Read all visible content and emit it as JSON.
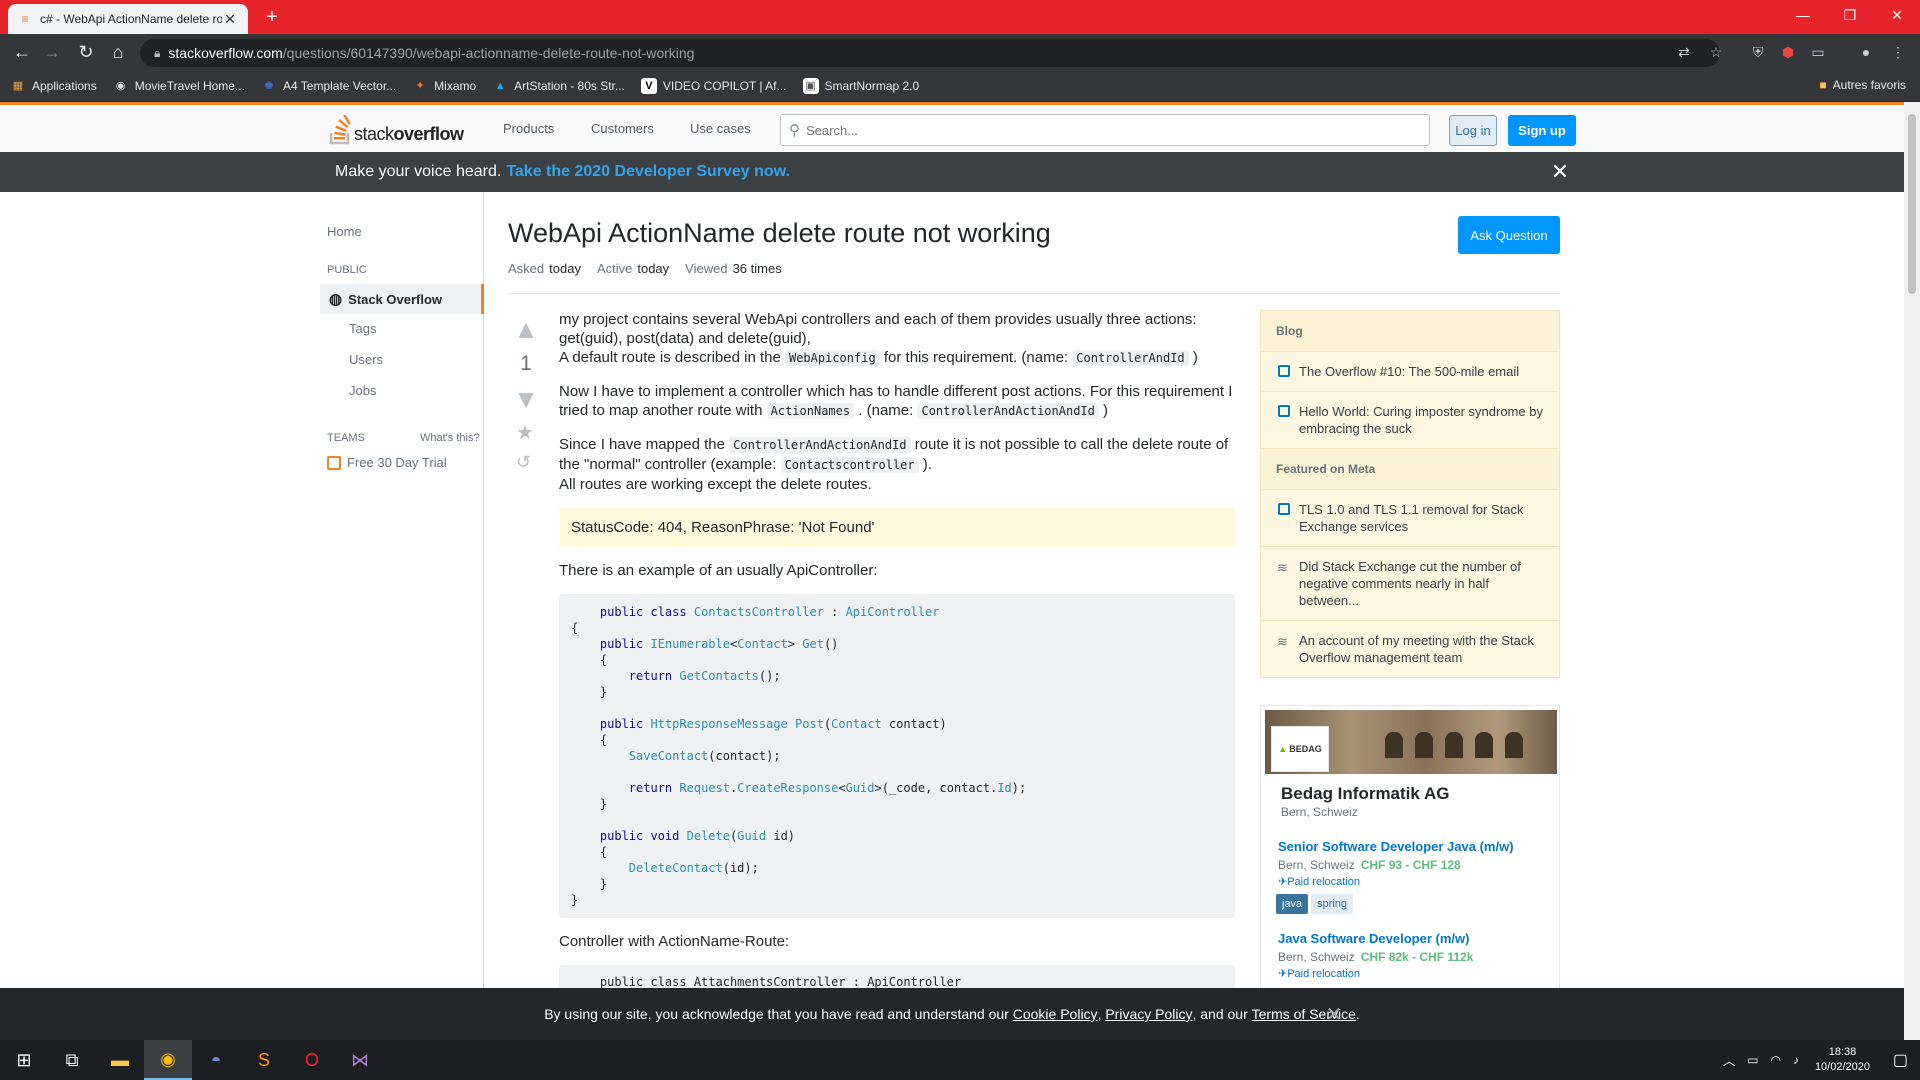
{
  "browser": {
    "tab_title": "c# - WebApi ActionName delete route not working",
    "url_domain": "stackoverflow.com",
    "url_path": "/questions/60147390/webapi-actionname-delete-route-not-working",
    "bookmarks": [
      {
        "label": "Applications",
        "icon": "apps-grid-icon",
        "color": "#e8a03e"
      },
      {
        "label": "MovieTravel Home...",
        "icon": "globe-icon",
        "color": "#cccccc"
      },
      {
        "label": "A4 Template Vector...",
        "icon": "freepik-icon",
        "color": "#3b7be8"
      },
      {
        "label": "Mixamo",
        "icon": "mixamo-icon",
        "color": "#e87b2e"
      },
      {
        "label": "ArtStation - 80s Str...",
        "icon": "artstation-icon",
        "color": "#13aff0"
      },
      {
        "label": "VIDEO COPILOT | Af...",
        "icon": "videocopilot-icon",
        "color": "#ffffff"
      },
      {
        "label": "SmartNormap 2.0",
        "icon": "smartnormap-icon",
        "color": "#ffffff"
      }
    ],
    "other_bookmarks": "Autres favoris"
  },
  "header": {
    "logo_text_light": "stack",
    "logo_text_bold": "overflow",
    "nav": [
      "Products",
      "Customers",
      "Use cases"
    ],
    "search_placeholder": "Search...",
    "login": "Log in",
    "signup": "Sign up"
  },
  "banner": {
    "text": "Make your voice heard.",
    "link": "Take the 2020 Developer Survey now."
  },
  "leftnav": {
    "home": "Home",
    "public": "PUBLIC",
    "stack_overflow": "Stack Overflow",
    "tags": "Tags",
    "users": "Users",
    "jobs": "Jobs",
    "teams": "TEAMS",
    "whats_this": "What's this?",
    "trial": "Free 30 Day Trial"
  },
  "question": {
    "title": "WebApi ActionName delete route not working",
    "ask_button": "Ask Question",
    "asked_label": "Asked",
    "asked_value": "today",
    "active_label": "Active",
    "active_value": "today",
    "viewed_label": "Viewed",
    "viewed_value": "36 times",
    "votes": "1",
    "p1_a": "my project contains several WebApi controllers and each of them provides usually three actions: get(guid), post(data) and delete(guid),",
    "p1_b": "A default route is described in the",
    "p1_code1": "WebApiconfig",
    "p1_c": "for this requirement. (name:",
    "p1_code2": "ControllerAndId",
    "p1_d": ")",
    "p2_a": "Now I have to implement a controller which has to handle different post actions. For this requirement I tried to map another route with",
    "p2_code1": "ActionNames",
    "p2_b": ". (name:",
    "p2_code2": "ControllerAndActionAndId",
    "p2_c": ")",
    "p3_a": "Since I have mapped the",
    "p3_code1": "ControllerAndActionAndId",
    "p3_b": "route it is not possible to call the delete route of the \"normal\" controller (example:",
    "p3_code2": "Contactscontroller",
    "p3_c": ").",
    "p3_d": "All routes are working except the delete routes.",
    "quote": "StatusCode: 404, ReasonPhrase: 'Not Found'",
    "p4": "There is an example of an usually ApiController:",
    "p5": "Controller with ActionName-Route:",
    "code2_first": "    public class AttachmentsController : ApiController"
  },
  "sidebar": {
    "blog_head": "Blog",
    "blog": [
      "The Overflow #10: The 500-mile email",
      "Hello World: Curing imposter syndrome by embracing the suck"
    ],
    "meta_head": "Featured on Meta",
    "meta": [
      "TLS 1.0 and TLS 1.1 removal for Stack Exchange services",
      "Did Stack Exchange cut the number of negative comments nearly in half between...",
      "An account of my meeting with the Stack Overflow management team"
    ]
  },
  "job_ad": {
    "logo_text": "BEDAG",
    "company": "Bedag Informatik AG",
    "location": "Bern, Schweiz",
    "jobs": [
      {
        "title": "Senior Software Developer Java (m/w)",
        "location": "Bern, Schweiz",
        "salary": "CHF 93 - CHF 128",
        "relocation": "Paid relocation"
      },
      {
        "title": "Java Software Developer (m/w)",
        "location": "Bern, Schweiz",
        "salary": "CHF 82k - CHF 112k",
        "relocation": "Paid relocation"
      }
    ],
    "tags": [
      "java",
      "spring"
    ]
  },
  "cookie": {
    "text_a": "By using our site, you acknowledge that you have read and understand our",
    "cookie_policy": "Cookie Policy",
    "comma": ",",
    "privacy_policy": "Privacy Policy",
    "and_our": ", and our",
    "terms": "Terms of Service",
    "period": "."
  },
  "taskbar": {
    "time": "18:38",
    "date": "10/02/2020"
  },
  "colors": {
    "so_orange": "#f48024",
    "so_blue": "#0095ff",
    "chrome_tab_red": "#e8242b"
  }
}
